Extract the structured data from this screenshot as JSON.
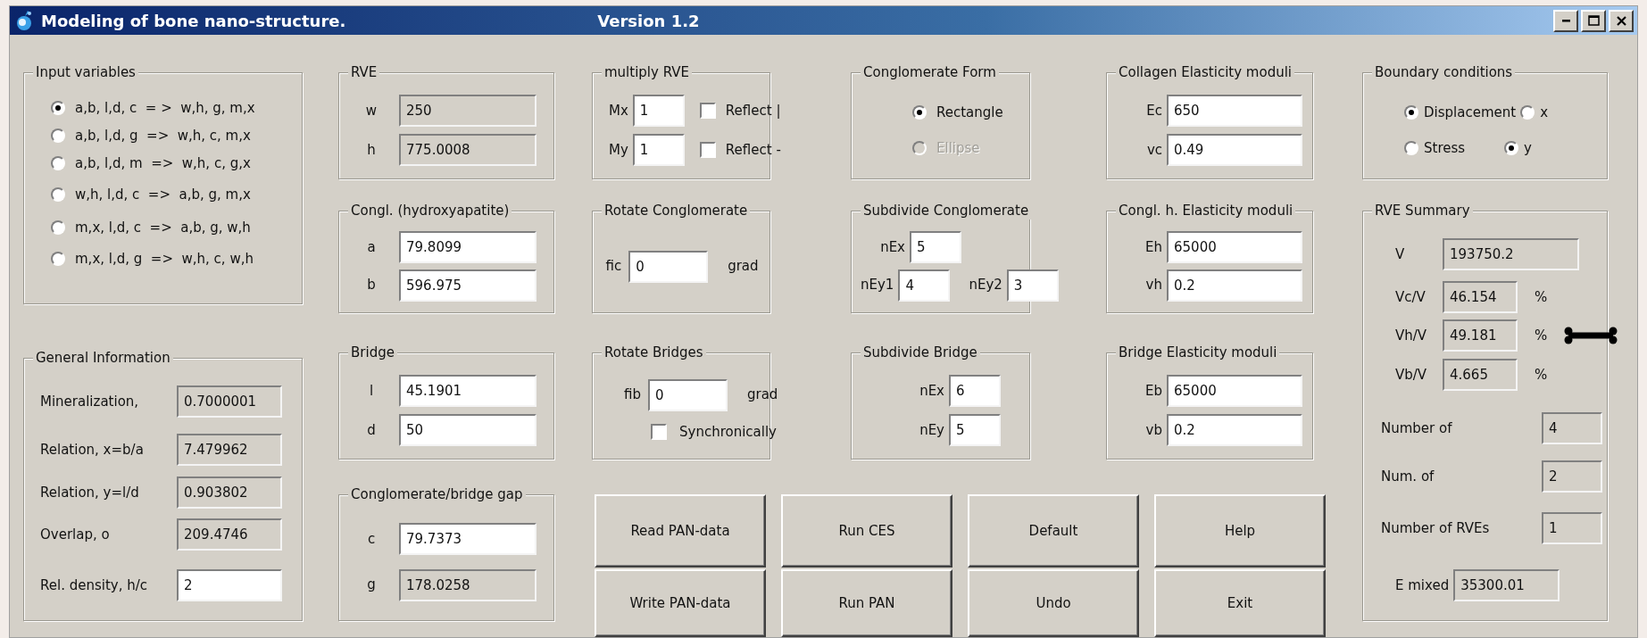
{
  "window": {
    "title": "Modeling of bone nano-structure.",
    "version": "Version 1.2"
  },
  "groups": [
    {
      "title": "Input variables",
      "rows": [
        {
          "items": [
            {
              "kind": "radio",
              "label": "a,b, l,d, c  = >  w,h, g, m,x",
              "selected": true
            }
          ]
        },
        {
          "items": [
            {
              "kind": "radio",
              "label": "a,b, l,d, g  =>  w,h, c, m,x",
              "selected": false
            }
          ]
        },
        {
          "items": [
            {
              "kind": "radio",
              "label": "a,b, l,d, m  =>  w,h, c, g,x",
              "selected": false
            }
          ]
        },
        {
          "items": [
            {
              "kind": "radio",
              "label": "w,h, l,d, c  =>  a,b, g, m,x",
              "selected": false
            }
          ]
        },
        {
          "items": [
            {
              "kind": "radio",
              "label": "m,x, l,d, c  =>  a,b, g, w,h",
              "selected": false
            }
          ]
        },
        {
          "items": [
            {
              "kind": "radio",
              "label": "m,x, l,d, g  =>  w,h, c, w,h",
              "selected": false
            }
          ]
        }
      ]
    },
    {
      "title": "General Information",
      "rows": [
        {
          "items": [
            {
              "kind": "label",
              "text": "Mineralization,"
            },
            {
              "kind": "field",
              "value": "0.7000001",
              "readonly": true
            }
          ]
        },
        {
          "items": [
            {
              "kind": "label",
              "text": "Relation, x=b/a"
            },
            {
              "kind": "field",
              "value": "7.479962",
              "readonly": true
            }
          ]
        },
        {
          "items": [
            {
              "kind": "label",
              "text": "Relation, y=l/d"
            },
            {
              "kind": "field",
              "value": "0.903802",
              "readonly": true
            }
          ]
        },
        {
          "items": [
            {
              "kind": "label",
              "text": "Overlap, o"
            },
            {
              "kind": "field",
              "value": "209.4746",
              "readonly": true
            }
          ]
        },
        {
          "items": [
            {
              "kind": "label",
              "text": "Rel. density, h/c"
            },
            {
              "kind": "field",
              "value": "2",
              "readonly": false
            }
          ]
        }
      ]
    },
    {
      "title": "RVE",
      "rows": [
        {
          "items": [
            {
              "kind": "label",
              "text": "w"
            },
            {
              "kind": "field",
              "value": "250",
              "readonly": true
            }
          ]
        },
        {
          "items": [
            {
              "kind": "label",
              "text": "h"
            },
            {
              "kind": "field",
              "value": "775.0008",
              "readonly": true
            }
          ]
        }
      ]
    },
    {
      "title": "Congl. (hydroxyapatite)",
      "rows": [
        {
          "items": [
            {
              "kind": "label",
              "text": "a"
            },
            {
              "kind": "field",
              "value": "79.8099",
              "readonly": false
            }
          ]
        },
        {
          "items": [
            {
              "kind": "label",
              "text": "b"
            },
            {
              "kind": "field",
              "value": "596.975",
              "readonly": false
            }
          ]
        }
      ]
    },
    {
      "title": "Bridge",
      "rows": [
        {
          "items": [
            {
              "kind": "label",
              "text": "l"
            },
            {
              "kind": "field",
              "value": "45.1901",
              "readonly": false
            }
          ]
        },
        {
          "items": [
            {
              "kind": "label",
              "text": "d"
            },
            {
              "kind": "field",
              "value": "50",
              "readonly": false
            }
          ]
        }
      ]
    },
    {
      "title": "Conglomerate/bridge gap",
      "rows": [
        {
          "items": [
            {
              "kind": "label",
              "text": "c"
            },
            {
              "kind": "field",
              "value": "79.7373",
              "readonly": false
            }
          ]
        },
        {
          "items": [
            {
              "kind": "label",
              "text": "g"
            },
            {
              "kind": "field",
              "value": "178.0258",
              "readonly": true
            }
          ]
        }
      ]
    },
    {
      "title": "multiply RVE",
      "rows": [
        {
          "items": [
            {
              "kind": "label",
              "text": "Mx"
            },
            {
              "kind": "field",
              "value": "1",
              "readonly": false
            },
            {
              "kind": "checkbox",
              "label": "Reflect |",
              "checked": false
            }
          ]
        },
        {
          "items": [
            {
              "kind": "label",
              "text": "My"
            },
            {
              "kind": "field",
              "value": "1",
              "readonly": false
            },
            {
              "kind": "checkbox",
              "label": "Reflect -",
              "checked": false
            }
          ]
        }
      ]
    },
    {
      "title": "Rotate Conglomerate",
      "rows": [
        {
          "items": [
            {
              "kind": "label",
              "text": "fic"
            },
            {
              "kind": "field",
              "value": "0",
              "readonly": false
            },
            {
              "kind": "unit",
              "text": "grad"
            }
          ]
        }
      ]
    },
    {
      "title": "Rotate Bridges",
      "rows": [
        {
          "items": [
            {
              "kind": "label",
              "text": "fib"
            },
            {
              "kind": "field",
              "value": "0",
              "readonly": false
            },
            {
              "kind": "unit",
              "text": "grad"
            }
          ]
        },
        {
          "items": [
            {
              "kind": "checkbox",
              "label": "Synchronically",
              "checked": false
            }
          ]
        }
      ]
    },
    {
      "title": "Conglomerate Form",
      "rows": [
        {
          "items": [
            {
              "kind": "radio",
              "label": "Rectangle",
              "selected": true,
              "disabled": false
            }
          ]
        },
        {
          "items": [
            {
              "kind": "radio",
              "label": "Ellipse",
              "selected": false,
              "disabled": true
            }
          ]
        }
      ]
    },
    {
      "title": "Subdivide Conglomerate",
      "rows": [
        {
          "items": [
            {
              "kind": "label",
              "text": "nEx"
            },
            {
              "kind": "field",
              "value": "5",
              "readonly": false
            }
          ]
        },
        {
          "items": [
            {
              "kind": "label",
              "text": "nEy1"
            },
            {
              "kind": "field",
              "value": "4",
              "readonly": false
            },
            {
              "kind": "label",
              "text": "nEy2"
            },
            {
              "kind": "field",
              "value": "3",
              "readonly": false
            }
          ]
        }
      ]
    },
    {
      "title": "Subdivide Bridge",
      "rows": [
        {
          "items": [
            {
              "kind": "label",
              "text": "nEx"
            },
            {
              "kind": "field",
              "value": "6",
              "readonly": false
            }
          ]
        },
        {
          "items": [
            {
              "kind": "label",
              "text": "nEy"
            },
            {
              "kind": "field",
              "value": "5",
              "readonly": false
            }
          ]
        }
      ]
    },
    {
      "title": "Collagen Elasticity moduli",
      "rows": [
        {
          "items": [
            {
              "kind": "label",
              "text": "Ec"
            },
            {
              "kind": "field",
              "value": "650",
              "readonly": false
            }
          ]
        },
        {
          "items": [
            {
              "kind": "label",
              "text": "vc"
            },
            {
              "kind": "field",
              "value": "0.49",
              "readonly": false
            }
          ]
        }
      ]
    },
    {
      "title": "Congl. h. Elasticity moduli",
      "rows": [
        {
          "items": [
            {
              "kind": "label",
              "text": "Eh"
            },
            {
              "kind": "field",
              "value": "65000",
              "readonly": false
            }
          ]
        },
        {
          "items": [
            {
              "kind": "label",
              "text": "vh"
            },
            {
              "kind": "field",
              "value": "0.2",
              "readonly": false
            }
          ]
        }
      ]
    },
    {
      "title": "Bridge Elasticity moduli",
      "rows": [
        {
          "items": [
            {
              "kind": "label",
              "text": "Eb"
            },
            {
              "kind": "field",
              "value": "65000",
              "readonly": false
            }
          ]
        },
        {
          "items": [
            {
              "kind": "label",
              "text": "vb"
            },
            {
              "kind": "field",
              "value": "0.2",
              "readonly": false
            }
          ]
        }
      ]
    },
    {
      "title": "Boundary conditions",
      "rows": [
        {
          "items": [
            {
              "kind": "radio",
              "label": "Displacement",
              "selected": true
            },
            {
              "kind": "radio",
              "label": "x",
              "selected": false
            }
          ]
        },
        {
          "items": [
            {
              "kind": "radio",
              "label": "Stress",
              "selected": false
            },
            {
              "kind": "radio",
              "label": "y",
              "selected": true
            }
          ]
        }
      ]
    },
    {
      "title": "RVE Summary",
      "rows": [
        {
          "items": [
            {
              "kind": "label",
              "text": "V"
            },
            {
              "kind": "field",
              "value": "193750.2",
              "readonly": true
            }
          ]
        },
        {
          "items": [
            {
              "kind": "label",
              "text": "Vc/V"
            },
            {
              "kind": "field",
              "value": "46.154",
              "readonly": true
            },
            {
              "kind": "unit",
              "text": "%"
            }
          ]
        },
        {
          "items": [
            {
              "kind": "label",
              "text": "Vh/V"
            },
            {
              "kind": "field",
              "value": "49.181",
              "readonly": true
            },
            {
              "kind": "unit",
              "text": "%"
            }
          ]
        },
        {
          "items": [
            {
              "kind": "label",
              "text": "Vb/V"
            },
            {
              "kind": "field",
              "value": "4.665",
              "readonly": true
            },
            {
              "kind": "unit",
              "text": "%"
            }
          ]
        },
        {
          "items": [
            {
              "kind": "label",
              "text": "Number of"
            },
            {
              "kind": "field",
              "value": "4",
              "readonly": true
            }
          ]
        },
        {
          "items": [
            {
              "kind": "label",
              "text": "Num. of"
            },
            {
              "kind": "field",
              "value": "2",
              "readonly": true
            }
          ]
        },
        {
          "items": [
            {
              "kind": "label",
              "text": "Number of RVEs"
            },
            {
              "kind": "field",
              "value": "1",
              "readonly": true
            }
          ]
        },
        {
          "items": [
            {
              "kind": "label",
              "text": "E mixed"
            },
            {
              "kind": "field",
              "value": "35300.01",
              "readonly": true
            }
          ]
        }
      ]
    }
  ],
  "buttons": [
    "Read PAN-data",
    "Run CES",
    "Default",
    "Help",
    "Write PAN-data",
    "Run PAN",
    "Undo",
    "Exit"
  ]
}
